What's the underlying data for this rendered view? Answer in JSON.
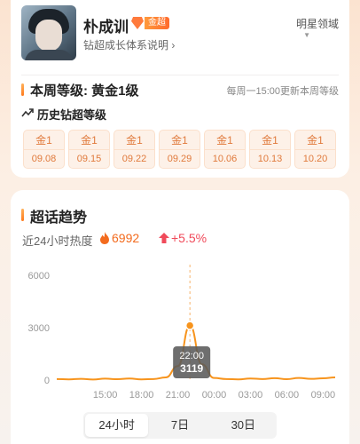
{
  "profile": {
    "name": "朴成训",
    "badge": "金超",
    "subtitle": "钻超成长体系说明",
    "subtitle_arrow": "›",
    "corner_link": "明星领域",
    "corner_arrow": "▼"
  },
  "level": {
    "title": "本周等级: 黄金1级",
    "note": "每周一15:00更新本周等级"
  },
  "history": {
    "title": "历史钻超等级",
    "weeks": [
      {
        "level": "金1",
        "date": "09.08"
      },
      {
        "level": "金1",
        "date": "09.15"
      },
      {
        "level": "金1",
        "date": "09.22"
      },
      {
        "level": "金1",
        "date": "09.29"
      },
      {
        "level": "金1",
        "date": "10.06"
      },
      {
        "level": "金1",
        "date": "10.13"
      },
      {
        "level": "金1",
        "date": "10.20"
      }
    ]
  },
  "trend": {
    "title": "超话趋势",
    "heat_label": "近24小时热度",
    "heat_value": "6992",
    "heat_change": "+5.5%"
  },
  "colors": {
    "accent": "#f7941d",
    "heat": "#f36b1e",
    "increase": "#f04a5a"
  },
  "icons": {
    "badge": "diamond-icon",
    "history": "trend-line-icon",
    "heat": "fire-icon",
    "change": "up-arrow-icon"
  },
  "chart_data": {
    "type": "line",
    "title": "",
    "xlabel": "",
    "ylabel": "",
    "ylim": [
      0,
      6000
    ],
    "yticks": [
      0,
      3000,
      6000
    ],
    "xticks": [
      "15:00",
      "18:00",
      "21:00",
      "00:00",
      "03:00",
      "06:00",
      "09:00"
    ],
    "grid": false,
    "series": [
      {
        "values": [
          {
            "x": "11:00",
            "y": 60
          },
          {
            "x": "12:00",
            "y": 40
          },
          {
            "x": "13:00",
            "y": 70
          },
          {
            "x": "14:00",
            "y": 30
          },
          {
            "x": "15:00",
            "y": 80
          },
          {
            "x": "16:00",
            "y": 50
          },
          {
            "x": "17:00",
            "y": 90
          },
          {
            "x": "18:00",
            "y": 40
          },
          {
            "x": "19:00",
            "y": 60
          },
          {
            "x": "20:00",
            "y": 150
          },
          {
            "x": "21:00",
            "y": 800
          },
          {
            "x": "22:00",
            "y": 3119
          },
          {
            "x": "23:00",
            "y": 900
          },
          {
            "x": "00:00",
            "y": 120
          },
          {
            "x": "01:00",
            "y": 60
          },
          {
            "x": "02:00",
            "y": 40
          },
          {
            "x": "03:00",
            "y": 90
          },
          {
            "x": "04:00",
            "y": 60
          },
          {
            "x": "05:00",
            "y": 110
          },
          {
            "x": "06:00",
            "y": 50
          },
          {
            "x": "07:00",
            "y": 120
          },
          {
            "x": "08:00",
            "y": 70
          },
          {
            "x": "09:00",
            "y": 100
          },
          {
            "x": "10:00",
            "y": 150
          }
        ]
      }
    ],
    "tooltip": {
      "x": "22:00",
      "y": "3119"
    }
  },
  "range_tabs": {
    "items": [
      "24小时",
      "7日",
      "30日"
    ],
    "selected": "24小时"
  }
}
